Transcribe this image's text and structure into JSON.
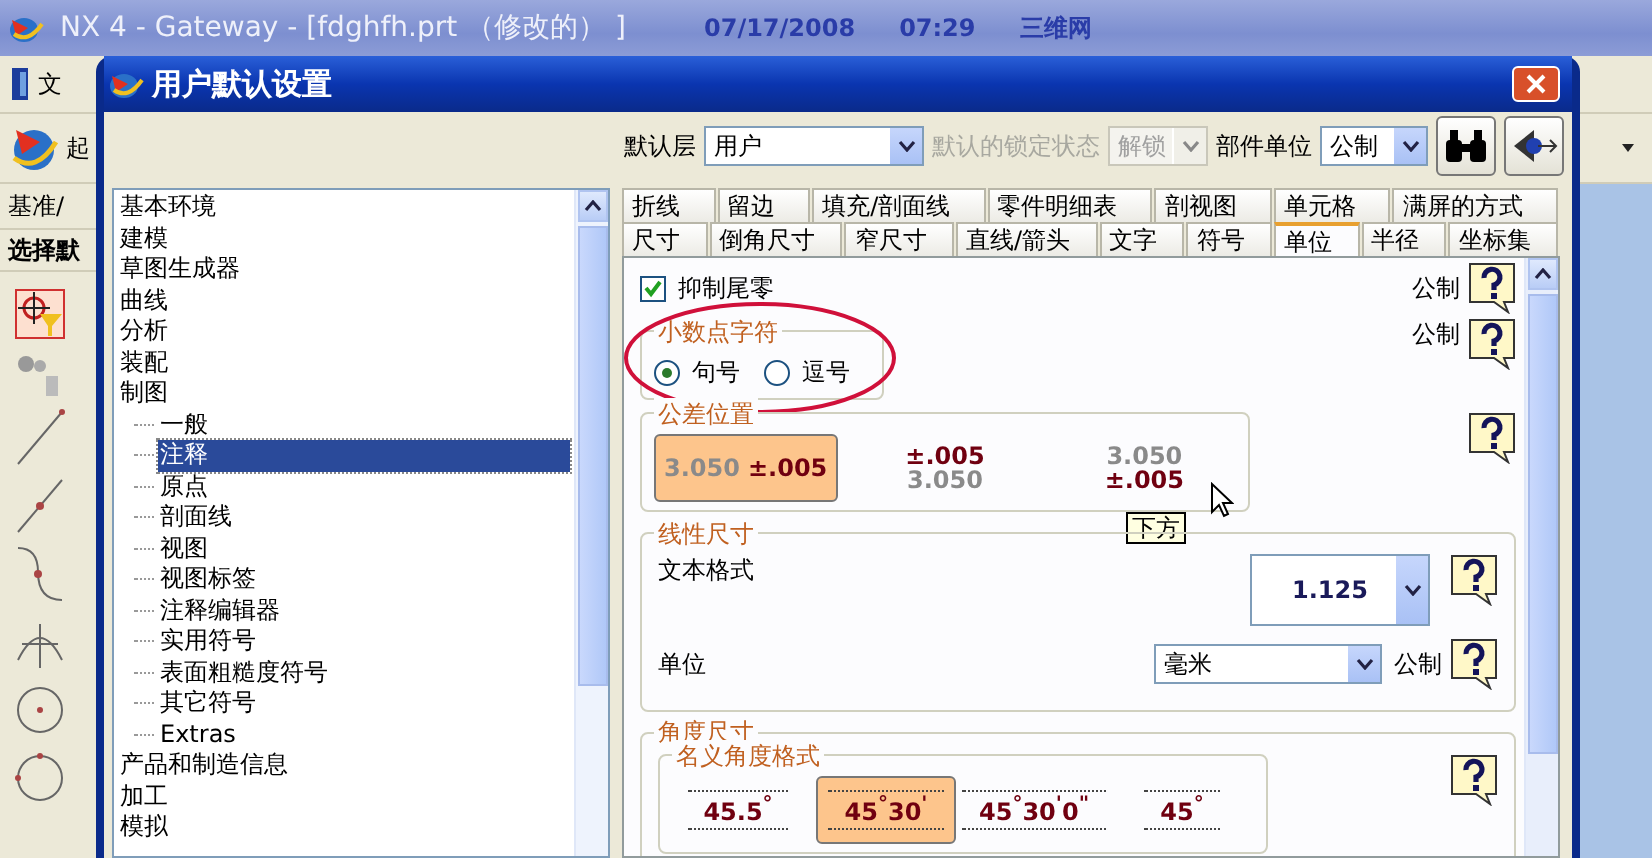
{
  "app": {
    "title": "NX 4 - Gateway - [fdghfh.prt （修改的） ]",
    "date": "07/17/2008",
    "time": "07:29",
    "site": "三维网",
    "menu_item": "文",
    "toolbar_item": "起",
    "toolbar_label": "基准/",
    "selection_label": "选择默"
  },
  "dialog": {
    "title": "用户默认设置",
    "toolbar": {
      "layer_label": "默认层",
      "layer_value": "用户",
      "lock_label": "默认的锁定状态",
      "lock_value": "解锁",
      "lock_disabled": true,
      "units_label": "部件单位",
      "units_value": "公制"
    },
    "tree": [
      {
        "label": "基本环境",
        "selected": false
      },
      {
        "label": "建模",
        "selected": false
      },
      {
        "label": "草图生成器",
        "selected": false
      },
      {
        "label": "曲线",
        "selected": false
      },
      {
        "label": "分析",
        "selected": false
      },
      {
        "label": "装配",
        "selected": false
      },
      {
        "label": "制图",
        "selected": false,
        "children": [
          {
            "label": "一般",
            "selected": false
          },
          {
            "label": "注释",
            "selected": true
          },
          {
            "label": "原点",
            "selected": false
          },
          {
            "label": "剖面线",
            "selected": false
          },
          {
            "label": "视图",
            "selected": false
          },
          {
            "label": "视图标签",
            "selected": false
          },
          {
            "label": "注释编辑器",
            "selected": false
          },
          {
            "label": "实用符号",
            "selected": false
          },
          {
            "label": "表面粗糙度符号",
            "selected": false
          },
          {
            "label": "其它符号",
            "selected": false
          },
          {
            "label": "Extras",
            "selected": false
          }
        ]
      },
      {
        "label": "产品和制造信息",
        "selected": false
      },
      {
        "label": "加工",
        "selected": false
      },
      {
        "label": "模拟",
        "selected": false
      }
    ],
    "tab_rows": [
      {
        "tabs": [
          {
            "label": "折线",
            "selected": false
          },
          {
            "label": "留边",
            "selected": false
          },
          {
            "label": "填充/剖面线",
            "selected": false
          },
          {
            "label": "零件明细表",
            "selected": false
          },
          {
            "label": "剖视图",
            "selected": false
          },
          {
            "label": "单元格",
            "selected": false
          },
          {
            "label": "满屏的方式",
            "selected": false
          }
        ]
      },
      {
        "tabs": [
          {
            "label": "尺寸",
            "selected": false
          },
          {
            "label": "倒角尺寸",
            "selected": false
          },
          {
            "label": "窄尺寸",
            "selected": false
          },
          {
            "label": "直线/箭头",
            "selected": false
          },
          {
            "label": "文字",
            "selected": false
          },
          {
            "label": "符号",
            "selected": false
          },
          {
            "label": "单位",
            "selected": true
          },
          {
            "label": "半径",
            "selected": false
          },
          {
            "label": "坐标集",
            "selected": false
          }
        ]
      }
    ],
    "suppress_zeros": {
      "label": "抑制尾零",
      "checked": true,
      "standard": "公制"
    },
    "decimal_char": {
      "title": "小数点字符",
      "highlighted": true,
      "standard": "公制",
      "options": [
        {
          "label": "句号",
          "selected": true
        },
        {
          "label": "逗号",
          "selected": false
        }
      ]
    },
    "tolerance_position": {
      "title": "公差位置",
      "tooltip": "下方",
      "options": [
        {
          "kind": "inline",
          "nominal": "3.050",
          "tolerance": "±.005",
          "selected": true
        },
        {
          "kind": "above",
          "nominal": "3.050",
          "tolerance": "±.005",
          "selected": false
        },
        {
          "kind": "below",
          "nominal": "3.050",
          "tolerance": "±.005",
          "selected": false
        }
      ]
    },
    "linear": {
      "title": "线性尺寸",
      "text_format_label": "文本格式",
      "text_format_value": "1.125",
      "unit_label": "单位",
      "unit_value": "毫米",
      "unit_standard": "公制"
    },
    "angular": {
      "title": "角度尺寸",
      "format_title": "名义角度格式",
      "options": [
        {
          "text": "45.5$^{°}$",
          "selected": false
        },
        {
          "text": "45$^{°}$30$^{'}$",
          "selected": true
        },
        {
          "text": "45$^{°}$30$^{'}$0$^{\"}$",
          "selected": false
        },
        {
          "text": "45$^{°}$",
          "selected": false
        }
      ]
    }
  }
}
